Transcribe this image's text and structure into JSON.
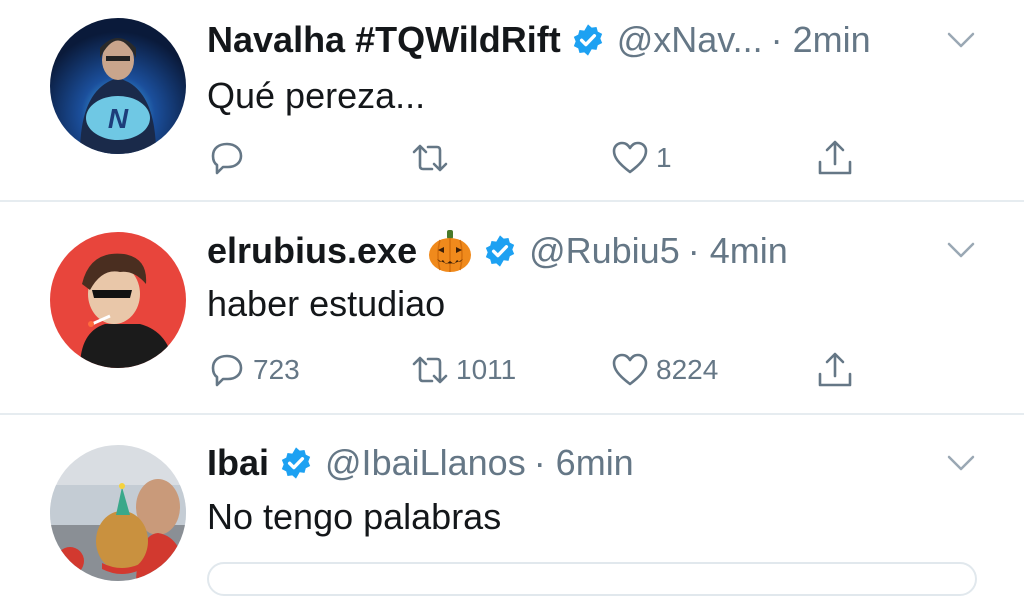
{
  "tweets": [
    {
      "name": "Navalha #TQWildRift",
      "handle": "@xNav...",
      "time": "· 2min",
      "text": "Qué pereza...",
      "replies": "",
      "retweets": "",
      "likes": "1",
      "verified": true,
      "avatar": "hooded-man-with-glowing-n-logo"
    },
    {
      "name": "elrubius.exe",
      "emoji": "jack-o-lantern",
      "handle": "@Rubiu5",
      "time": "· 4min",
      "text": "haber estudiao",
      "replies": "723",
      "retweets": "1011",
      "likes": "8224",
      "verified": true,
      "avatar": "cartoon-character-red-background"
    },
    {
      "name": "Ibai",
      "handle": "@IbaiLlanos",
      "time": "· 6min",
      "text": "No tengo palabras",
      "verified": true,
      "avatar": "man-with-dog-in-party-hat"
    }
  ],
  "colors": {
    "text": "#14171a",
    "secondary": "#657786",
    "verified": "#1da1f2",
    "divider": "#e6ecf0"
  },
  "icons": [
    "reply-icon",
    "retweet-icon",
    "like-icon",
    "share-icon",
    "verified-badge-icon",
    "chevron-down-icon"
  ]
}
